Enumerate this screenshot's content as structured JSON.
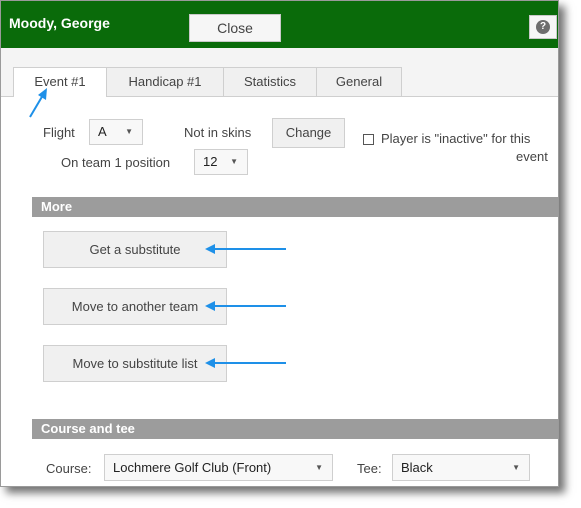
{
  "header": {
    "player_name": "Moody, George",
    "close_label": "Close",
    "help_glyph": "?"
  },
  "tabs": [
    {
      "label": "Event #1",
      "active": true
    },
    {
      "label": "Handicap #1",
      "active": false
    },
    {
      "label": "Statistics",
      "active": false
    },
    {
      "label": "General",
      "active": false
    }
  ],
  "event": {
    "flight_label": "Flight",
    "flight_value": "A",
    "skins_status": "Not in skins",
    "change_label": "Change",
    "inactive_label_line1": "Player is \"inactive\" for this",
    "inactive_label_line2": "event",
    "inactive_checked": false,
    "team_label": "On team 1 position",
    "team_position": "12"
  },
  "more": {
    "header": "More",
    "buttons": {
      "substitute": "Get a substitute",
      "move_team": "Move to another team",
      "move_sub_list": "Move to substitute list"
    }
  },
  "course_tee": {
    "header": "Course and tee",
    "course_label": "Course:",
    "course_value": "Lochmere Golf Club (Front)",
    "tee_label": "Tee:",
    "tee_value": "Black"
  },
  "colors": {
    "titlebar": "#0a6b0a",
    "section_header": "#9c9c9c",
    "annotation_arrow": "#1e90e8"
  },
  "icons": {
    "help": "help-icon",
    "dropdown": "chevron-down-icon",
    "annotation": "arrow-annotation"
  }
}
